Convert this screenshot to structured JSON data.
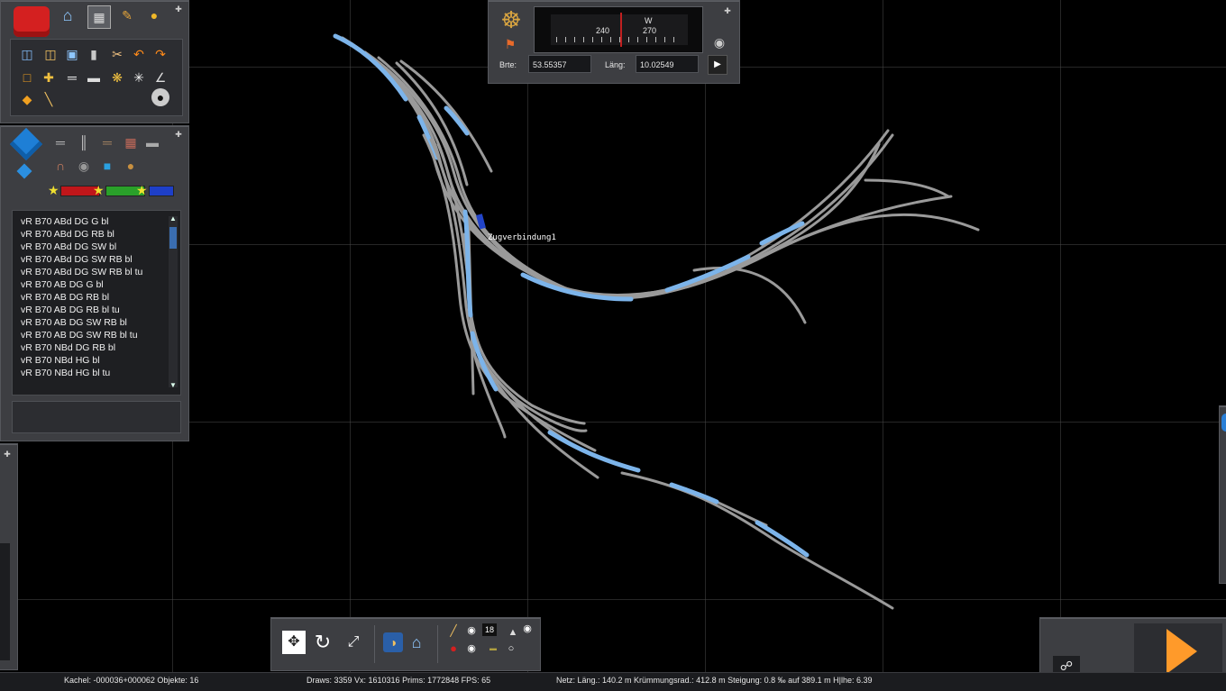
{
  "colors": {
    "background": "#000000",
    "grid": "#464646",
    "panel": "#3d3e42",
    "track": "#9a9a9a",
    "track_selected": "#7cb4ea",
    "play_accent": "#ff9a2a"
  },
  "toolbar_main": {
    "icons": [
      "toolbox-icon",
      "home-icon",
      "building-icon",
      "brush-icon",
      "train-icon"
    ],
    "tools": [
      "open-file-icon",
      "copy-icon",
      "monitor-icon",
      "trash-icon",
      "cut-icon",
      "undo-icon",
      "redo-icon",
      "select-box-icon",
      "track-split-icon",
      "track-connect-icon",
      "rail-icon",
      "star-gear-icon",
      "compass-star-icon",
      "angle-icon",
      "tag-icon",
      "ruler-icon",
      "bomb-icon"
    ]
  },
  "object_panel": {
    "category_icons": [
      "cube-icon",
      "track-straight-icon",
      "track-double-icon",
      "track-wood-icon",
      "brick-icon",
      "sleeper-icon",
      "bridge-icon",
      "turntable-icon",
      "water-icon",
      "bag-icon"
    ],
    "star_bars": [
      {
        "color": "#c0161a"
      },
      {
        "color": "#2aa02a"
      },
      {
        "color": "#1e3fc8"
      }
    ],
    "list_items": [
      "vR B70 ABd DG G bl",
      "vR B70 ABd DG RB bl",
      "vR B70 ABd DG SW bl",
      "vR B70 ABd DG SW RB bl",
      "vR B70 ABd DG SW RB bl tu",
      "vR B70 AB DG G bl",
      "vR B70 AB DG RB bl",
      "vR B70 AB DG RB bl tu",
      "vR B70 AB DG SW RB bl",
      "vR B70 AB DG SW RB bl tu",
      "vR B70 NBd DG RB bl",
      "vR B70 NBd HG bl",
      "vR B70 NBd HG bl tu"
    ]
  },
  "compass": {
    "heading_labels": [
      "240",
      "270"
    ],
    "direction": "W",
    "lat_label": "Brte:",
    "lat_value": "53.55357",
    "lon_label": "Läng:",
    "lon_value": "10.02549"
  },
  "track_label": "Zugverbindung1",
  "bottom_toolbar": {
    "number_value": "18",
    "icons": [
      "fit-view-icon",
      "rotate-icon",
      "resize-icon",
      "globe-icon",
      "home-icon",
      "signal-icon",
      "car-icon",
      "tsl-icon"
    ]
  },
  "statusbar": {
    "tile": "Kachel: -000036+000062  Objekte: 16",
    "stats": "Draws: 3359 Vx: 1610316 Prims: 1772848 FPS: 65",
    "net": "Netz:  Läng.:  140.2 m Krümmungsrad.: 412.8 m Steigung:  0.8 ‰ auf 389.1 m H|lhe:   6.39"
  }
}
